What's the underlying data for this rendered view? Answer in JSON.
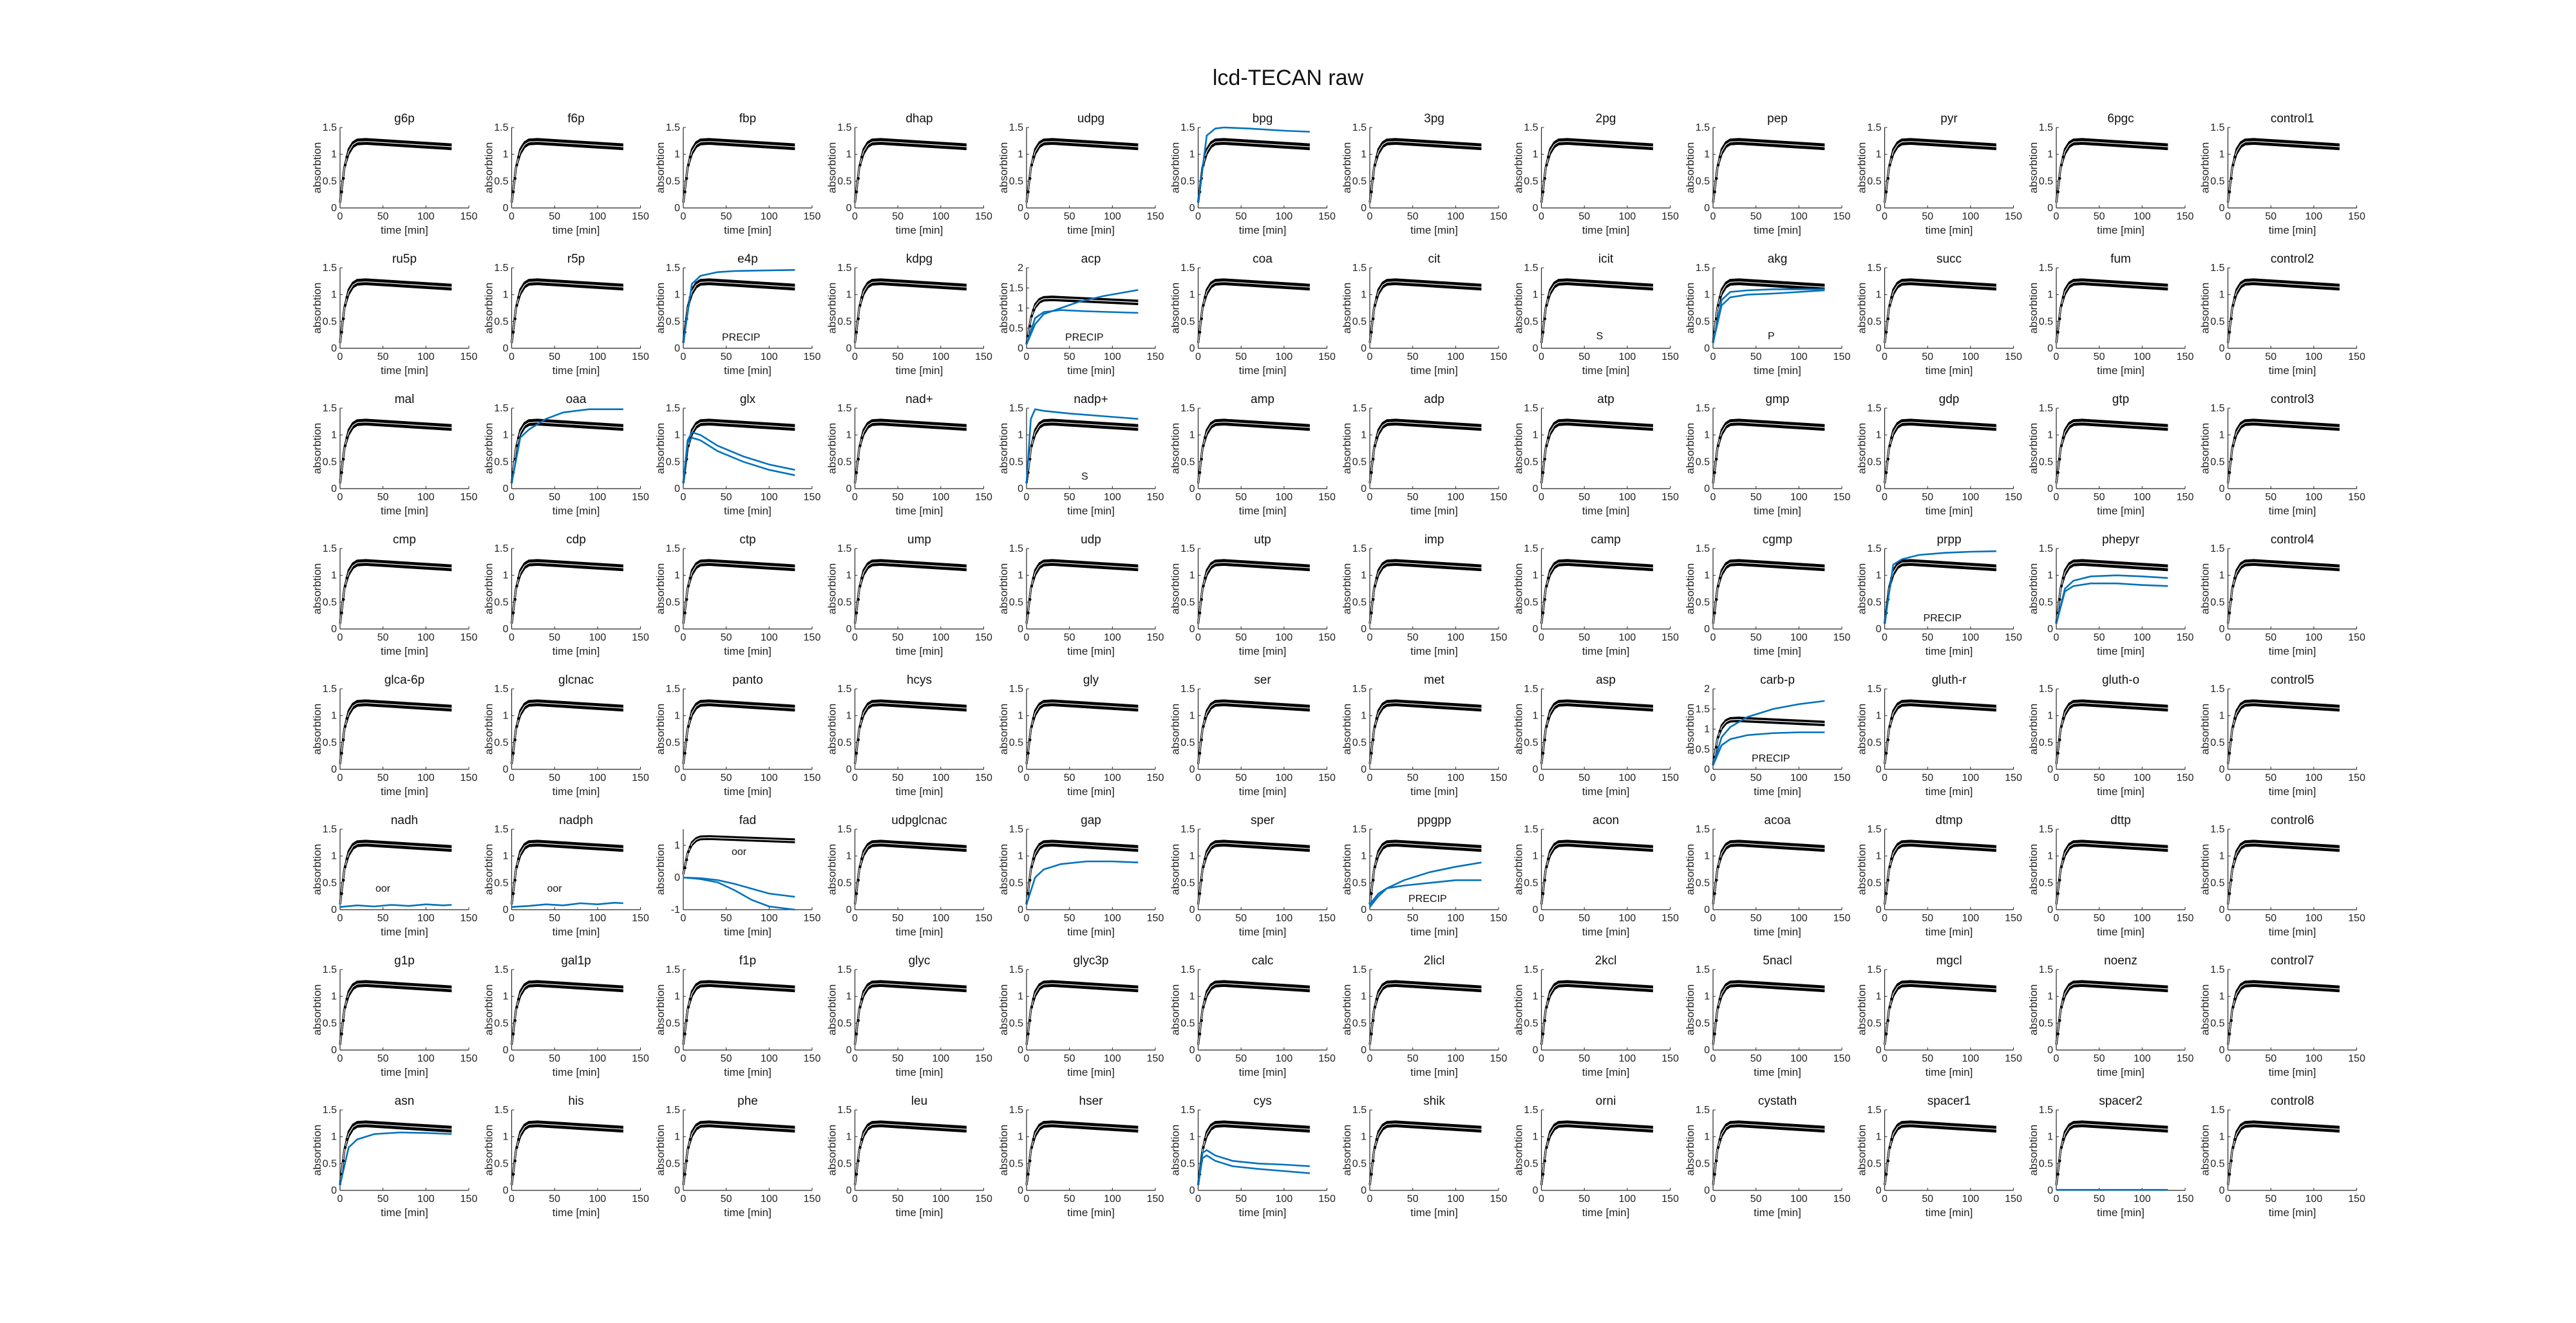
{
  "figure": {
    "title": "lcd-TECAN raw",
    "x_axis_label": "time [min]",
    "y_axis_label": "absorbtion"
  },
  "colors": {
    "control": "#000000",
    "sample": "#0072BD",
    "axis": "#262626"
  },
  "chart_data": {
    "type": "line",
    "layout": "small-multiples 8 rows x 12 columns",
    "xlim": [
      0,
      150
    ],
    "xticks": [
      0,
      50,
      100,
      150
    ],
    "default_ylim": [
      0,
      1.5
    ],
    "default_yticks": [
      0,
      0.5,
      1,
      1.5
    ],
    "baseline_curve": {
      "description": "control replicates (black band)",
      "x": [
        0,
        5,
        10,
        15,
        20,
        30,
        40,
        60,
        80,
        100,
        120,
        130
      ],
      "y": [
        0.1,
        0.75,
        1.05,
        1.18,
        1.23,
        1.24,
        1.23,
        1.21,
        1.19,
        1.17,
        1.15,
        1.14
      ]
    },
    "panels": [
      {
        "name": "g6p"
      },
      {
        "name": "f6p"
      },
      {
        "name": "fbp"
      },
      {
        "name": "dhap"
      },
      {
        "name": "udpg"
      },
      {
        "name": "bpg",
        "extra": [
          {
            "x": [
              0,
              10,
              20,
              30,
              60,
              100,
              130
            ],
            "y": [
              0.1,
              1.35,
              1.48,
              1.5,
              1.48,
              1.44,
              1.42
            ]
          }
        ]
      },
      {
        "name": "3pg"
      },
      {
        "name": "2pg"
      },
      {
        "name": "pep"
      },
      {
        "name": "pyr"
      },
      {
        "name": "6pgc"
      },
      {
        "name": "control1"
      },
      {
        "name": "ru5p"
      },
      {
        "name": "r5p"
      },
      {
        "name": "e4p",
        "note": "PRECIP",
        "extra": [
          {
            "x": [
              0,
              10,
              20,
              40,
              60,
              90,
              130
            ],
            "y": [
              0.1,
              1.2,
              1.35,
              1.42,
              1.44,
              1.45,
              1.46
            ]
          }
        ]
      },
      {
        "name": "kdpg"
      },
      {
        "name": "acp",
        "note": "PRECIP",
        "ylim": [
          0,
          2
        ],
        "yticks": [
          0,
          0.5,
          1,
          1.5,
          2
        ],
        "extra": [
          {
            "x": [
              0,
              10,
              20,
              40,
              60,
              90,
              130
            ],
            "y": [
              0.1,
              0.6,
              0.85,
              1.0,
              1.15,
              1.3,
              1.45
            ]
          },
          {
            "x": [
              0,
              10,
              20,
              40,
              70,
              100,
              130
            ],
            "y": [
              0.1,
              0.75,
              0.9,
              0.95,
              0.92,
              0.9,
              0.88
            ]
          }
        ]
      },
      {
        "name": "coa"
      },
      {
        "name": "cit"
      },
      {
        "name": "icit",
        "note": "S"
      },
      {
        "name": "akg",
        "note": "P",
        "extra": [
          {
            "x": [
              0,
              10,
              20,
              40,
              70,
              100,
              130
            ],
            "y": [
              0.1,
              0.8,
              0.95,
              1.0,
              1.02,
              1.05,
              1.08
            ]
          },
          {
            "x": [
              0,
              10,
              20,
              40,
              70,
              100,
              130
            ],
            "y": [
              0.1,
              0.9,
              1.05,
              1.08,
              1.1,
              1.1,
              1.1
            ]
          }
        ]
      },
      {
        "name": "succ"
      },
      {
        "name": "fum"
      },
      {
        "name": "control2"
      },
      {
        "name": "mal"
      },
      {
        "name": "oaa",
        "extra": [
          {
            "x": [
              0,
              10,
              20,
              40,
              60,
              90,
              130
            ],
            "y": [
              0.1,
              0.95,
              1.1,
              1.3,
              1.42,
              1.48,
              1.48
            ]
          }
        ]
      },
      {
        "name": "glx",
        "extra": [
          {
            "x": [
              0,
              5,
              10,
              20,
              40,
              70,
              100,
              130
            ],
            "y": [
              0.1,
              0.9,
              1.05,
              1.0,
              0.8,
              0.6,
              0.45,
              0.35
            ]
          },
          {
            "x": [
              0,
              5,
              10,
              20,
              40,
              70,
              100,
              130
            ],
            "y": [
              0.1,
              0.85,
              0.95,
              0.9,
              0.7,
              0.5,
              0.35,
              0.25
            ]
          }
        ]
      },
      {
        "name": "nad+"
      },
      {
        "name": "nadp+",
        "note": "S",
        "extra": [
          {
            "x": [
              0,
              5,
              10,
              20,
              50,
              90,
              130
            ],
            "y": [
              0.1,
              1.3,
              1.48,
              1.45,
              1.4,
              1.35,
              1.3
            ]
          }
        ]
      },
      {
        "name": "amp"
      },
      {
        "name": "adp"
      },
      {
        "name": "atp"
      },
      {
        "name": "gmp"
      },
      {
        "name": "gdp"
      },
      {
        "name": "gtp"
      },
      {
        "name": "control3"
      },
      {
        "name": "cmp"
      },
      {
        "name": "cdp"
      },
      {
        "name": "ctp"
      },
      {
        "name": "ump"
      },
      {
        "name": "udp"
      },
      {
        "name": "utp"
      },
      {
        "name": "imp"
      },
      {
        "name": "camp"
      },
      {
        "name": "cgmp"
      },
      {
        "name": "prpp",
        "note": "PRECIP",
        "extra": [
          {
            "x": [
              0,
              10,
              20,
              40,
              70,
              100,
              130
            ],
            "y": [
              0.1,
              1.2,
              1.3,
              1.38,
              1.42,
              1.44,
              1.45
            ]
          }
        ]
      },
      {
        "name": "phepyr",
        "extra": [
          {
            "x": [
              0,
              10,
              20,
              40,
              70,
              100,
              130
            ],
            "y": [
              0.1,
              0.75,
              0.9,
              0.98,
              1.0,
              0.98,
              0.95
            ]
          },
          {
            "x": [
              0,
              10,
              20,
              40,
              70,
              100,
              130
            ],
            "y": [
              0.1,
              0.7,
              0.8,
              0.85,
              0.85,
              0.82,
              0.8
            ]
          }
        ]
      },
      {
        "name": "control4"
      },
      {
        "name": "glca-6p"
      },
      {
        "name": "glcnac"
      },
      {
        "name": "panto"
      },
      {
        "name": "hcys"
      },
      {
        "name": "gly"
      },
      {
        "name": "ser"
      },
      {
        "name": "met"
      },
      {
        "name": "asp"
      },
      {
        "name": "carb-p",
        "note": "PRECIP",
        "ylim": [
          0,
          2
        ],
        "yticks": [
          0,
          0.5,
          1,
          1.5,
          2
        ],
        "extra": [
          {
            "x": [
              0,
              10,
              20,
              40,
              70,
              100,
              130
            ],
            "y": [
              0.1,
              0.8,
              1.05,
              1.3,
              1.5,
              1.62,
              1.7
            ]
          },
          {
            "x": [
              0,
              10,
              20,
              40,
              70,
              100,
              130
            ],
            "y": [
              0.1,
              0.6,
              0.75,
              0.85,
              0.9,
              0.92,
              0.92
            ]
          }
        ]
      },
      {
        "name": "gluth-r"
      },
      {
        "name": "gluth-o"
      },
      {
        "name": "control5"
      },
      {
        "name": "nadh",
        "note": "oor",
        "extra": [
          {
            "x": [
              0,
              20,
              40,
              60,
              80,
              100,
              120,
              130
            ],
            "y": [
              0.05,
              0.08,
              0.06,
              0.09,
              0.07,
              0.1,
              0.08,
              0.09
            ]
          }
        ]
      },
      {
        "name": "nadph",
        "note": "oor",
        "extra": [
          {
            "x": [
              0,
              20,
              40,
              60,
              80,
              100,
              120,
              130
            ],
            "y": [
              0.05,
              0.07,
              0.1,
              0.08,
              0.12,
              0.1,
              0.13,
              0.12
            ]
          }
        ]
      },
      {
        "name": "fad",
        "note": "oor",
        "ylim": [
          -1,
          1.5
        ],
        "yticks": [
          -1,
          0,
          1
        ],
        "extra": [
          {
            "x": [
              0,
              20,
              40,
              60,
              80,
              100,
              130
            ],
            "y": [
              0,
              -0.05,
              -0.15,
              -0.4,
              -0.7,
              -0.9,
              -1.0
            ]
          },
          {
            "x": [
              0,
              20,
              40,
              60,
              80,
              100,
              130
            ],
            "y": [
              0,
              -0.02,
              -0.08,
              -0.2,
              -0.35,
              -0.5,
              -0.6
            ]
          }
        ]
      },
      {
        "name": "udpglcnac"
      },
      {
        "name": "gap",
        "extra": [
          {
            "x": [
              0,
              10,
              20,
              40,
              70,
              100,
              130
            ],
            "y": [
              0.1,
              0.6,
              0.75,
              0.85,
              0.9,
              0.9,
              0.88
            ]
          }
        ]
      },
      {
        "name": "sper"
      },
      {
        "name": "ppgpp",
        "note": "PRECIP",
        "extra": [
          {
            "x": [
              0,
              10,
              20,
              40,
              70,
              100,
              130
            ],
            "y": [
              0.05,
              0.25,
              0.4,
              0.55,
              0.7,
              0.8,
              0.88
            ]
          },
          {
            "x": [
              0,
              10,
              20,
              40,
              70,
              100,
              130
            ],
            "y": [
              0.1,
              0.3,
              0.4,
              0.45,
              0.5,
              0.55,
              0.55
            ]
          }
        ]
      },
      {
        "name": "acon"
      },
      {
        "name": "acoa"
      },
      {
        "name": "dtmp"
      },
      {
        "name": "dttp"
      },
      {
        "name": "control6"
      },
      {
        "name": "g1p"
      },
      {
        "name": "gal1p"
      },
      {
        "name": "f1p"
      },
      {
        "name": "glyc"
      },
      {
        "name": "glyc3p"
      },
      {
        "name": "calc"
      },
      {
        "name": "2licl"
      },
      {
        "name": "2kcl"
      },
      {
        "name": "5nacl"
      },
      {
        "name": "mgcl"
      },
      {
        "name": "noenz"
      },
      {
        "name": "control7"
      },
      {
        "name": "asn",
        "extra": [
          {
            "x": [
              0,
              10,
              20,
              40,
              70,
              100,
              130
            ],
            "y": [
              0.1,
              0.8,
              0.95,
              1.05,
              1.08,
              1.07,
              1.05
            ]
          }
        ]
      },
      {
        "name": "his"
      },
      {
        "name": "phe"
      },
      {
        "name": "leu"
      },
      {
        "name": "hser"
      },
      {
        "name": "cys",
        "extra": [
          {
            "x": [
              0,
              5,
              10,
              20,
              40,
              70,
              100,
              130
            ],
            "y": [
              0.1,
              0.7,
              0.75,
              0.65,
              0.55,
              0.5,
              0.48,
              0.45
            ]
          },
          {
            "x": [
              0,
              5,
              10,
              20,
              40,
              70,
              100,
              130
            ],
            "y": [
              0.1,
              0.6,
              0.65,
              0.55,
              0.45,
              0.4,
              0.36,
              0.32
            ]
          }
        ]
      },
      {
        "name": "shik"
      },
      {
        "name": "orni"
      },
      {
        "name": "cystath"
      },
      {
        "name": "spacer1"
      },
      {
        "name": "spacer2",
        "extra": [
          {
            "x": [
              0,
              130
            ],
            "y": [
              0.01,
              0.01
            ]
          }
        ]
      },
      {
        "name": "control8"
      }
    ]
  }
}
